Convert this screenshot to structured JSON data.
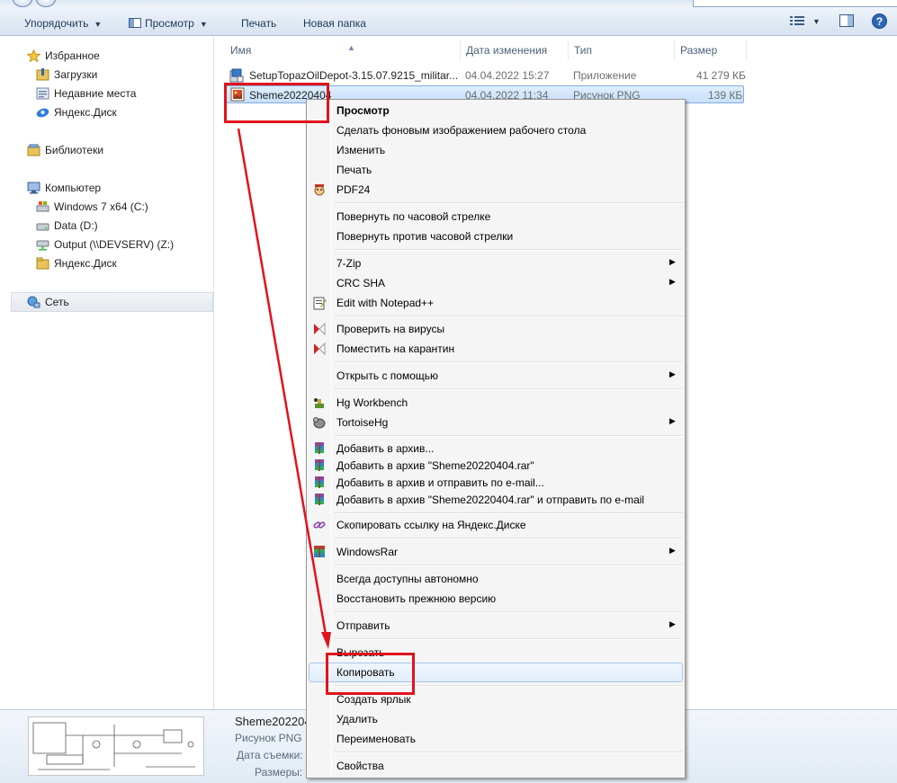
{
  "toolbar": {
    "organize": "Упорядочить",
    "view": "Просмотр",
    "print": "Печать",
    "new_folder": "Новая папка"
  },
  "nav": {
    "favorites": "Избранное",
    "downloads": "Загрузки",
    "recent": "Недавние места",
    "yandex_disk_fav": "Яндекс.Диск",
    "libraries": "Библиотеки",
    "computer": "Компьютер",
    "drive_c": "Windows 7 x64 (C:)",
    "drive_d": "Data (D:)",
    "drive_z": "Output (\\\\DEVSERV) (Z:)",
    "yandex_disk_comp": "Яндекс.Диск",
    "network": "Сеть"
  },
  "columns": {
    "name": "Имя",
    "date": "Дата изменения",
    "type": "Тип",
    "size": "Размер"
  },
  "files": [
    {
      "name": "SetupTopazOilDepot-3.15.07.9215_militar...",
      "date": "04.04.2022 15:27",
      "type": "Приложение",
      "size": "41 279 КБ"
    },
    {
      "name": "Sheme20220404",
      "date": "04.04.2022 11:34",
      "type": "Рисунок PNG",
      "size": "139 КБ"
    }
  ],
  "details": {
    "name": "Sheme2022040",
    "type": "Рисунок PNG",
    "shot_label": "Дата съемки:",
    "dims_label": "Размеры:"
  },
  "menu": {
    "preview": "Просмотр",
    "set_wallpaper": "Сделать фоновым изображением рабочего стола",
    "edit": "Изменить",
    "print": "Печать",
    "pdf24": "PDF24",
    "rotate_cw": "Повернуть по часовой стрелке",
    "rotate_ccw": "Повернуть против часовой стрелки",
    "zip7": "7-Zip",
    "crc": "CRC SHA",
    "notepad": "Edit with Notepad++",
    "scan": "Проверить на вирусы",
    "quarantine": "Поместить на карантин",
    "open_with": "Открыть с помощью",
    "hg": "Hg Workbench",
    "tortoise": "TortoiseHg",
    "rar_add": "Добавить в архив...",
    "rar_add_named": "Добавить в архив \"Sheme20220404.rar\"",
    "rar_add_mail": "Добавить в архив и отправить по e-mail...",
    "rar_add_named_mail": "Добавить в архив \"Sheme20220404.rar\" и отправить по e-mail",
    "yandex_link": "Скопировать ссылку на Яндекс.Диске",
    "winrar": "WindowsRar",
    "offline": "Всегда доступны автономно",
    "restore": "Восстановить прежнюю версию",
    "send_to": "Отправить",
    "cut": "Вырезать",
    "copy": "Копировать",
    "shortcut": "Создать ярлык",
    "delete": "Удалить",
    "rename": "Переименовать",
    "properties": "Свойства"
  },
  "colors": {
    "annotation": "#e0141c",
    "selection": "#c7e0fb"
  }
}
